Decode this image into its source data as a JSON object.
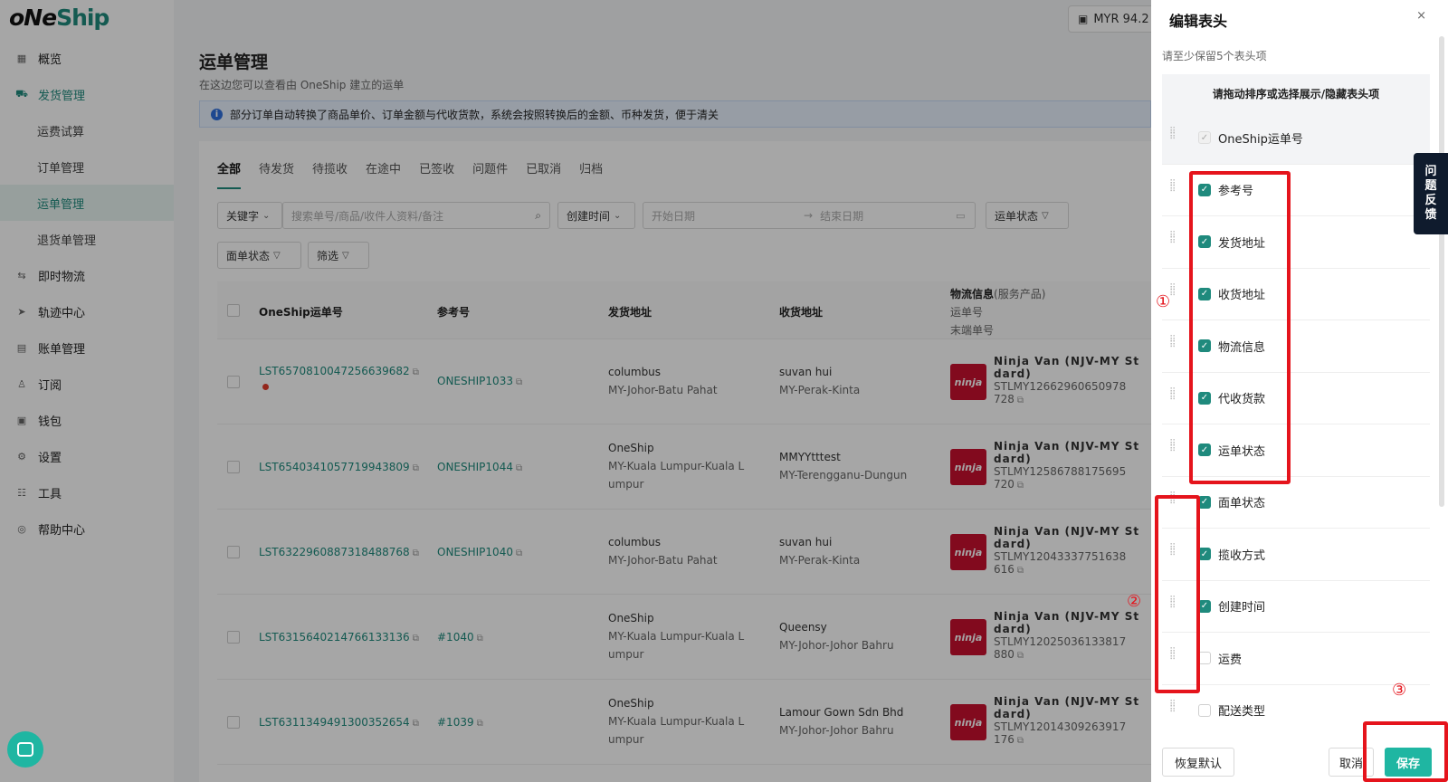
{
  "app": {
    "logo_one": "oNe",
    "logo_ship": "Ship"
  },
  "topbar": {
    "currency": "MYR 94.2"
  },
  "sidebar": {
    "items": [
      {
        "label": "概览",
        "icon": "grid-icon",
        "glyph": "▦"
      },
      {
        "label": "发货管理",
        "icon": "truck-icon",
        "glyph": "⛟"
      },
      {
        "label": "运费试算"
      },
      {
        "label": "订单管理"
      },
      {
        "label": "运单管理"
      },
      {
        "label": "退货单管理"
      },
      {
        "label": "即时物流",
        "icon": "delivery-icon",
        "glyph": "⇆"
      },
      {
        "label": "轨迹中心",
        "icon": "location-arrow-icon",
        "glyph": "➤"
      },
      {
        "label": "账单管理",
        "icon": "bill-icon",
        "glyph": "▤"
      },
      {
        "label": "订阅",
        "icon": "user-icon",
        "glyph": "♙"
      },
      {
        "label": "钱包",
        "icon": "wallet-icon",
        "glyph": "▣"
      },
      {
        "label": "设置",
        "icon": "gear-icon",
        "glyph": "⚙"
      },
      {
        "label": "工具",
        "icon": "tools-icon",
        "glyph": "☷"
      },
      {
        "label": "帮助中心",
        "icon": "help-icon",
        "glyph": "◎"
      }
    ]
  },
  "page": {
    "title": "运单管理",
    "subtitle": "在这边您可以查看由 OneShip 建立的运单",
    "notice": "部分订单自动转换了商品单价、订单金额与代收货款，系统会按照转换后的金额、币种发货，便于清关"
  },
  "tabs": [
    "全部",
    "待发货",
    "待揽收",
    "在途中",
    "已签收",
    "问题件",
    "已取消",
    "归档"
  ],
  "filters": {
    "keyword": "关键字",
    "search_placeholder": "搜索单号/商品/收件人资料/备注",
    "created_time": "创建时间",
    "start_date": "开始日期",
    "end_date": "结束日期",
    "waybill_status": "运单状态",
    "label_status": "面单状态",
    "filter": "筛选"
  },
  "table": {
    "headers": {
      "waybill_no": "OneShip运单号",
      "reference": "参考号",
      "sender": "发货地址",
      "receiver": "收货地址",
      "logistics": "物流信息",
      "logistics_service": "(服务产品)",
      "logistics_tracking": "运单号",
      "logistics_last_mile": "末端单号"
    },
    "rows": [
      {
        "waybill": "LST6570810047256639682",
        "ref": "ONESHIP1033",
        "sender_name": "columbus",
        "sender_addr": "MY-Johor-Batu Pahat",
        "sender_addr2": "",
        "receiver_name": "suvan hui",
        "receiver_addr": "MY-Perak-Kinta",
        "carrier": "Ninja Van (NJV-MY St",
        "carrier2": "dard)",
        "track": "STLMY12662960650978",
        "track2": "728"
      },
      {
        "waybill": "LST6540341057719943809",
        "ref": "ONESHIP1044",
        "sender_name": "OneShip",
        "sender_addr": "MY-Kuala Lumpur-Kuala L",
        "sender_addr2": "umpur",
        "receiver_name": "MMYYtttest",
        "receiver_addr": "MY-Terengganu-Dungun",
        "carrier": "Ninja Van (NJV-MY St",
        "carrier2": "dard)",
        "track": "STLMY12586788175695",
        "track2": "720"
      },
      {
        "waybill": "LST6322960887318488768",
        "ref": "ONESHIP1040",
        "sender_name": "columbus",
        "sender_addr": "MY-Johor-Batu Pahat",
        "sender_addr2": "",
        "receiver_name": "suvan hui",
        "receiver_addr": "MY-Perak-Kinta",
        "carrier": "Ninja Van (NJV-MY St",
        "carrier2": "dard)",
        "track": "STLMY12043337751638",
        "track2": "616"
      },
      {
        "waybill": "LST6315640214766133136",
        "ref": "#1040",
        "sender_name": "OneShip",
        "sender_addr": "MY-Kuala Lumpur-Kuala L",
        "sender_addr2": "umpur",
        "receiver_name": "Queensy",
        "receiver_addr": "MY-Johor-Johor Bahru",
        "carrier": "Ninja Van (NJV-MY St",
        "carrier2": "dard)",
        "track": "STLMY12025036133817",
        "track2": "880"
      },
      {
        "waybill": "LST6311349491300352654",
        "ref": "#1039",
        "sender_name": "OneShip",
        "sender_addr": "MY-Kuala Lumpur-Kuala L",
        "sender_addr2": "umpur",
        "receiver_name": "Lamour Gown Sdn Bhd",
        "receiver_addr": "MY-Johor-Johor Bahru",
        "carrier": "Ninja Van (NJV-MY St",
        "carrier2": "dard)",
        "track": "STLMY12014309263917",
        "track2": "176"
      }
    ],
    "ninja_logo": "ninja"
  },
  "drawer": {
    "title": "编辑表头",
    "close": "×",
    "tip": "请至少保留5个表头项",
    "box_title": "请拖动排序或选择展示/隐藏表头项",
    "columns": [
      {
        "label": "OneShip运单号",
        "state": "disabled"
      },
      {
        "label": "参考号",
        "state": "checked"
      },
      {
        "label": "发货地址",
        "state": "checked"
      },
      {
        "label": "收货地址",
        "state": "checked"
      },
      {
        "label": "物流信息",
        "state": "checked"
      },
      {
        "label": "代收货款",
        "state": "checked"
      },
      {
        "label": "运单状态",
        "state": "checked"
      },
      {
        "label": "面单状态",
        "state": "checked"
      },
      {
        "label": "揽收方式",
        "state": "checked"
      },
      {
        "label": "创建时间",
        "state": "checked"
      },
      {
        "label": "运费",
        "state": "unchecked"
      },
      {
        "label": "配送类型",
        "state": "unchecked"
      }
    ],
    "reset": "恢复默认",
    "cancel": "取消",
    "save": "保存"
  },
  "feedback": [
    "问",
    "题",
    "反",
    "馈"
  ],
  "annotations": [
    "①",
    "②",
    "③"
  ],
  "colors": {
    "brand": "#1f8a7d",
    "primary_button": "#1fb6a2",
    "annotation": "#e5141c"
  }
}
